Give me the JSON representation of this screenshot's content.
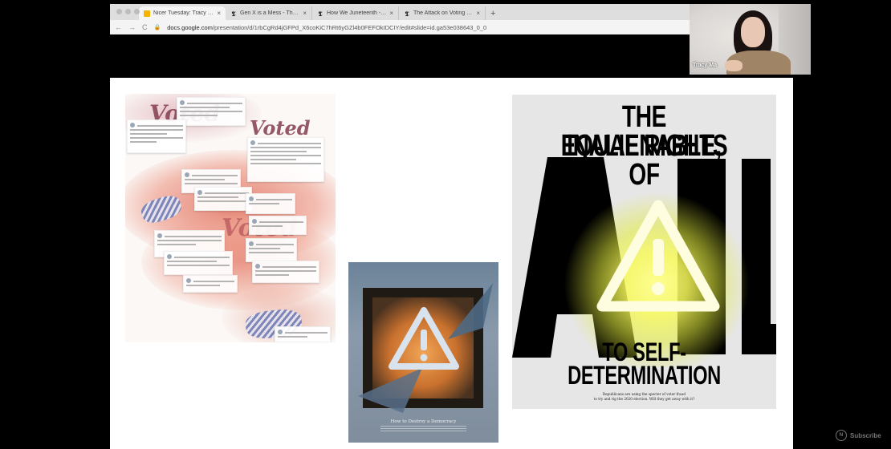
{
  "browser": {
    "tabs": [
      {
        "label": "Nicer Tuesday: Tracy Ma Octo",
        "icon": "slides-icon",
        "active": true
      },
      {
        "label": "Gen X is a Mess - The New Yo",
        "icon": "nyt-icon",
        "active": false
      },
      {
        "label": "How We Juneteenth - The New",
        "icon": "nyt-icon",
        "active": false
      },
      {
        "label": "The Attack on Voting in the 2",
        "icon": "nyt-icon",
        "active": false
      }
    ],
    "new_tab": "+",
    "url_host": "docs.google.com",
    "url_path": "/presentation/d/1rbCgRd4jGFPd_X6coKiC7hRt6yGZl4b0FEFOkIDCIY/edit#slide=id.ga53e038643_0_0",
    "back": "←",
    "forward": "→",
    "reload": "C",
    "lock": "🔒"
  },
  "webcam": {
    "name": "Tracy Ma"
  },
  "slide": {
    "collage": {
      "voted_words": [
        "Voted",
        "Voted",
        "Voted"
      ]
    },
    "poster_mid": {
      "title": "How to Destroy a Democracy"
    },
    "poster_right": {
      "headline_1": "THE INALIENABLE,",
      "headline_2": "EQUAL RIGHTS OF",
      "big_word": "ALL",
      "headline_3": "TO SELF-",
      "headline_4": "DETERMINATION",
      "sub_1": "Republicans are using the specter of voter fraud",
      "sub_2": "to try and rig the 2020 election. Will they get away with it?"
    }
  },
  "watermark": {
    "label": "Subscribe",
    "logo": "N"
  },
  "colors": {
    "glow": "#f8fa5a",
    "poster_bg": "#e6e6e6",
    "collage_red": "#dc5c46"
  }
}
